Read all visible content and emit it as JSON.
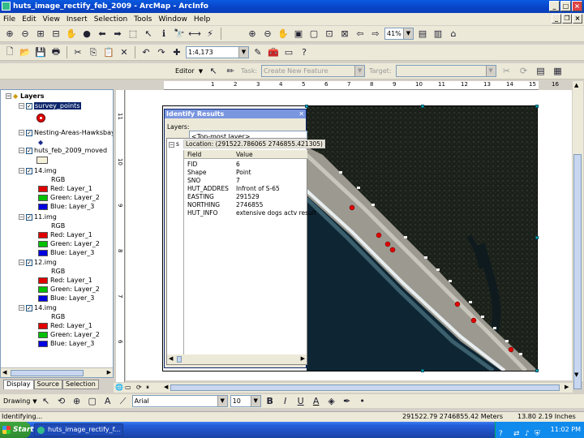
{
  "window": {
    "title": "huts_image_rectify_feb_2009 - ArcMap - ArcInfo"
  },
  "menu": [
    "File",
    "Edit",
    "View",
    "Insert",
    "Selection",
    "Tools",
    "Window",
    "Help"
  ],
  "toolbar": {
    "zoom_percent": "41%",
    "scale": "1:4,173"
  },
  "editor": {
    "editor_label": "Editor",
    "task_label": "Task:",
    "task_value": "Create New Feature",
    "target_label": "Target:"
  },
  "ruler": {
    "ticks": [
      "1",
      "2",
      "3",
      "4",
      "5",
      "6",
      "7",
      "8",
      "9",
      "10",
      "11",
      "12",
      "13",
      "14",
      "15",
      "16"
    ]
  },
  "vruler": {
    "ticks": [
      "11",
      "10",
      "9",
      "8",
      "7",
      "6"
    ]
  },
  "toc": {
    "root": "Layers",
    "layers": [
      {
        "name": "survey_points",
        "selected": true
      },
      {
        "name": "Nesting-Areas-Hawksbay"
      },
      {
        "name": "huts_feb_2009_moved"
      },
      {
        "name": "14.img",
        "rgb": "RGB",
        "bands": [
          "Red:   Layer_1",
          "Green: Layer_2",
          "Blue:   Layer_3"
        ]
      },
      {
        "name": "11.img",
        "rgb": "RGB",
        "bands": [
          "Red:   Layer_1",
          "Green: Layer_2",
          "Blue:   Layer_3"
        ]
      },
      {
        "name": "12.img",
        "rgb": "RGB",
        "bands": [
          "Red:   Layer_1",
          "Green: Layer_2",
          "Blue:   Layer_3"
        ]
      },
      {
        "name": "14.img",
        "rgb": "RGB",
        "bands": [
          "Red:   Layer_1",
          "Green: Layer_2",
          "Blue:   Layer_3"
        ]
      }
    ],
    "tabs": [
      "Display",
      "Source",
      "Selection"
    ]
  },
  "identify": {
    "title": "Identify Results",
    "layers_label": "Layers:",
    "layers_value": "<Top-most layer>",
    "tree_label": "s",
    "location": "Location: (291522.786065 2746855.421305)",
    "columns": [
      "Field",
      "Value"
    ],
    "rows": [
      [
        "FID",
        "6"
      ],
      [
        "Shape",
        "Point"
      ],
      [
        "SNO",
        "7"
      ],
      [
        "HUT_ADDRES",
        "Infront of S-65"
      ],
      [
        "EASTING",
        "291529"
      ],
      [
        "NORTHING",
        "2746855"
      ],
      [
        "HUT_INFO",
        "extensive dogs actv result"
      ]
    ]
  },
  "drawing": {
    "label": "Drawing",
    "font": "Arial",
    "size": "10",
    "bold": "B",
    "italic": "I",
    "underline": "U",
    "font_color": "A"
  },
  "status": {
    "left": "Identifying...",
    "coords": "291522.79  2746855.42 Meters",
    "page": "13.80  2.19 Inches"
  },
  "taskbar": {
    "start": "Start",
    "task": "huts_image_rectify_f...",
    "clock": "11:02 PM"
  },
  "colors": {
    "red": "#e00000",
    "green": "#00c000",
    "blue": "#0000e0",
    "title_blue": "#0843c7"
  }
}
